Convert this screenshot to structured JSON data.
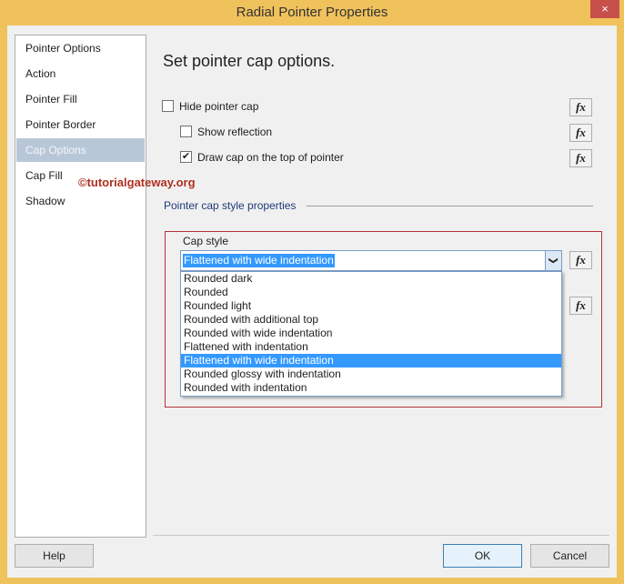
{
  "window": {
    "title": "Radial Pointer Properties",
    "close_icon": "×"
  },
  "sidebar": {
    "items": [
      {
        "label": "Pointer Options",
        "selected": false
      },
      {
        "label": "Action",
        "selected": false
      },
      {
        "label": "Pointer Fill",
        "selected": false
      },
      {
        "label": "Pointer Border",
        "selected": false
      },
      {
        "label": "Cap Options",
        "selected": true
      },
      {
        "label": "Cap Fill",
        "selected": false
      },
      {
        "label": "Shadow",
        "selected": false
      }
    ]
  },
  "main": {
    "heading": "Set pointer cap options.",
    "hide_pointer_cap": {
      "label": "Hide pointer cap",
      "checked": false
    },
    "show_reflection": {
      "label": "Show reflection",
      "checked": false
    },
    "draw_cap_on_top": {
      "label": "Draw cap on the top of pointer",
      "checked": true,
      "mark": "✔"
    },
    "fx_label": "fx",
    "group_label": "Pointer cap style properties",
    "cap_style": {
      "label": "Cap style",
      "value": "Flattened with wide indentation",
      "arrow": "❯",
      "options": [
        "Rounded dark",
        "Rounded",
        "Rounded light",
        "Rounded with additional top",
        "Rounded with wide indentation",
        "Flattened with indentation",
        "Flattened with wide indentation",
        "Rounded glossy with indentation",
        "Rounded with indentation"
      ],
      "selected_index": 6
    }
  },
  "watermark": "©tutorialgateway.org",
  "buttons": {
    "help": "Help",
    "ok": "OK",
    "cancel": "Cancel"
  }
}
